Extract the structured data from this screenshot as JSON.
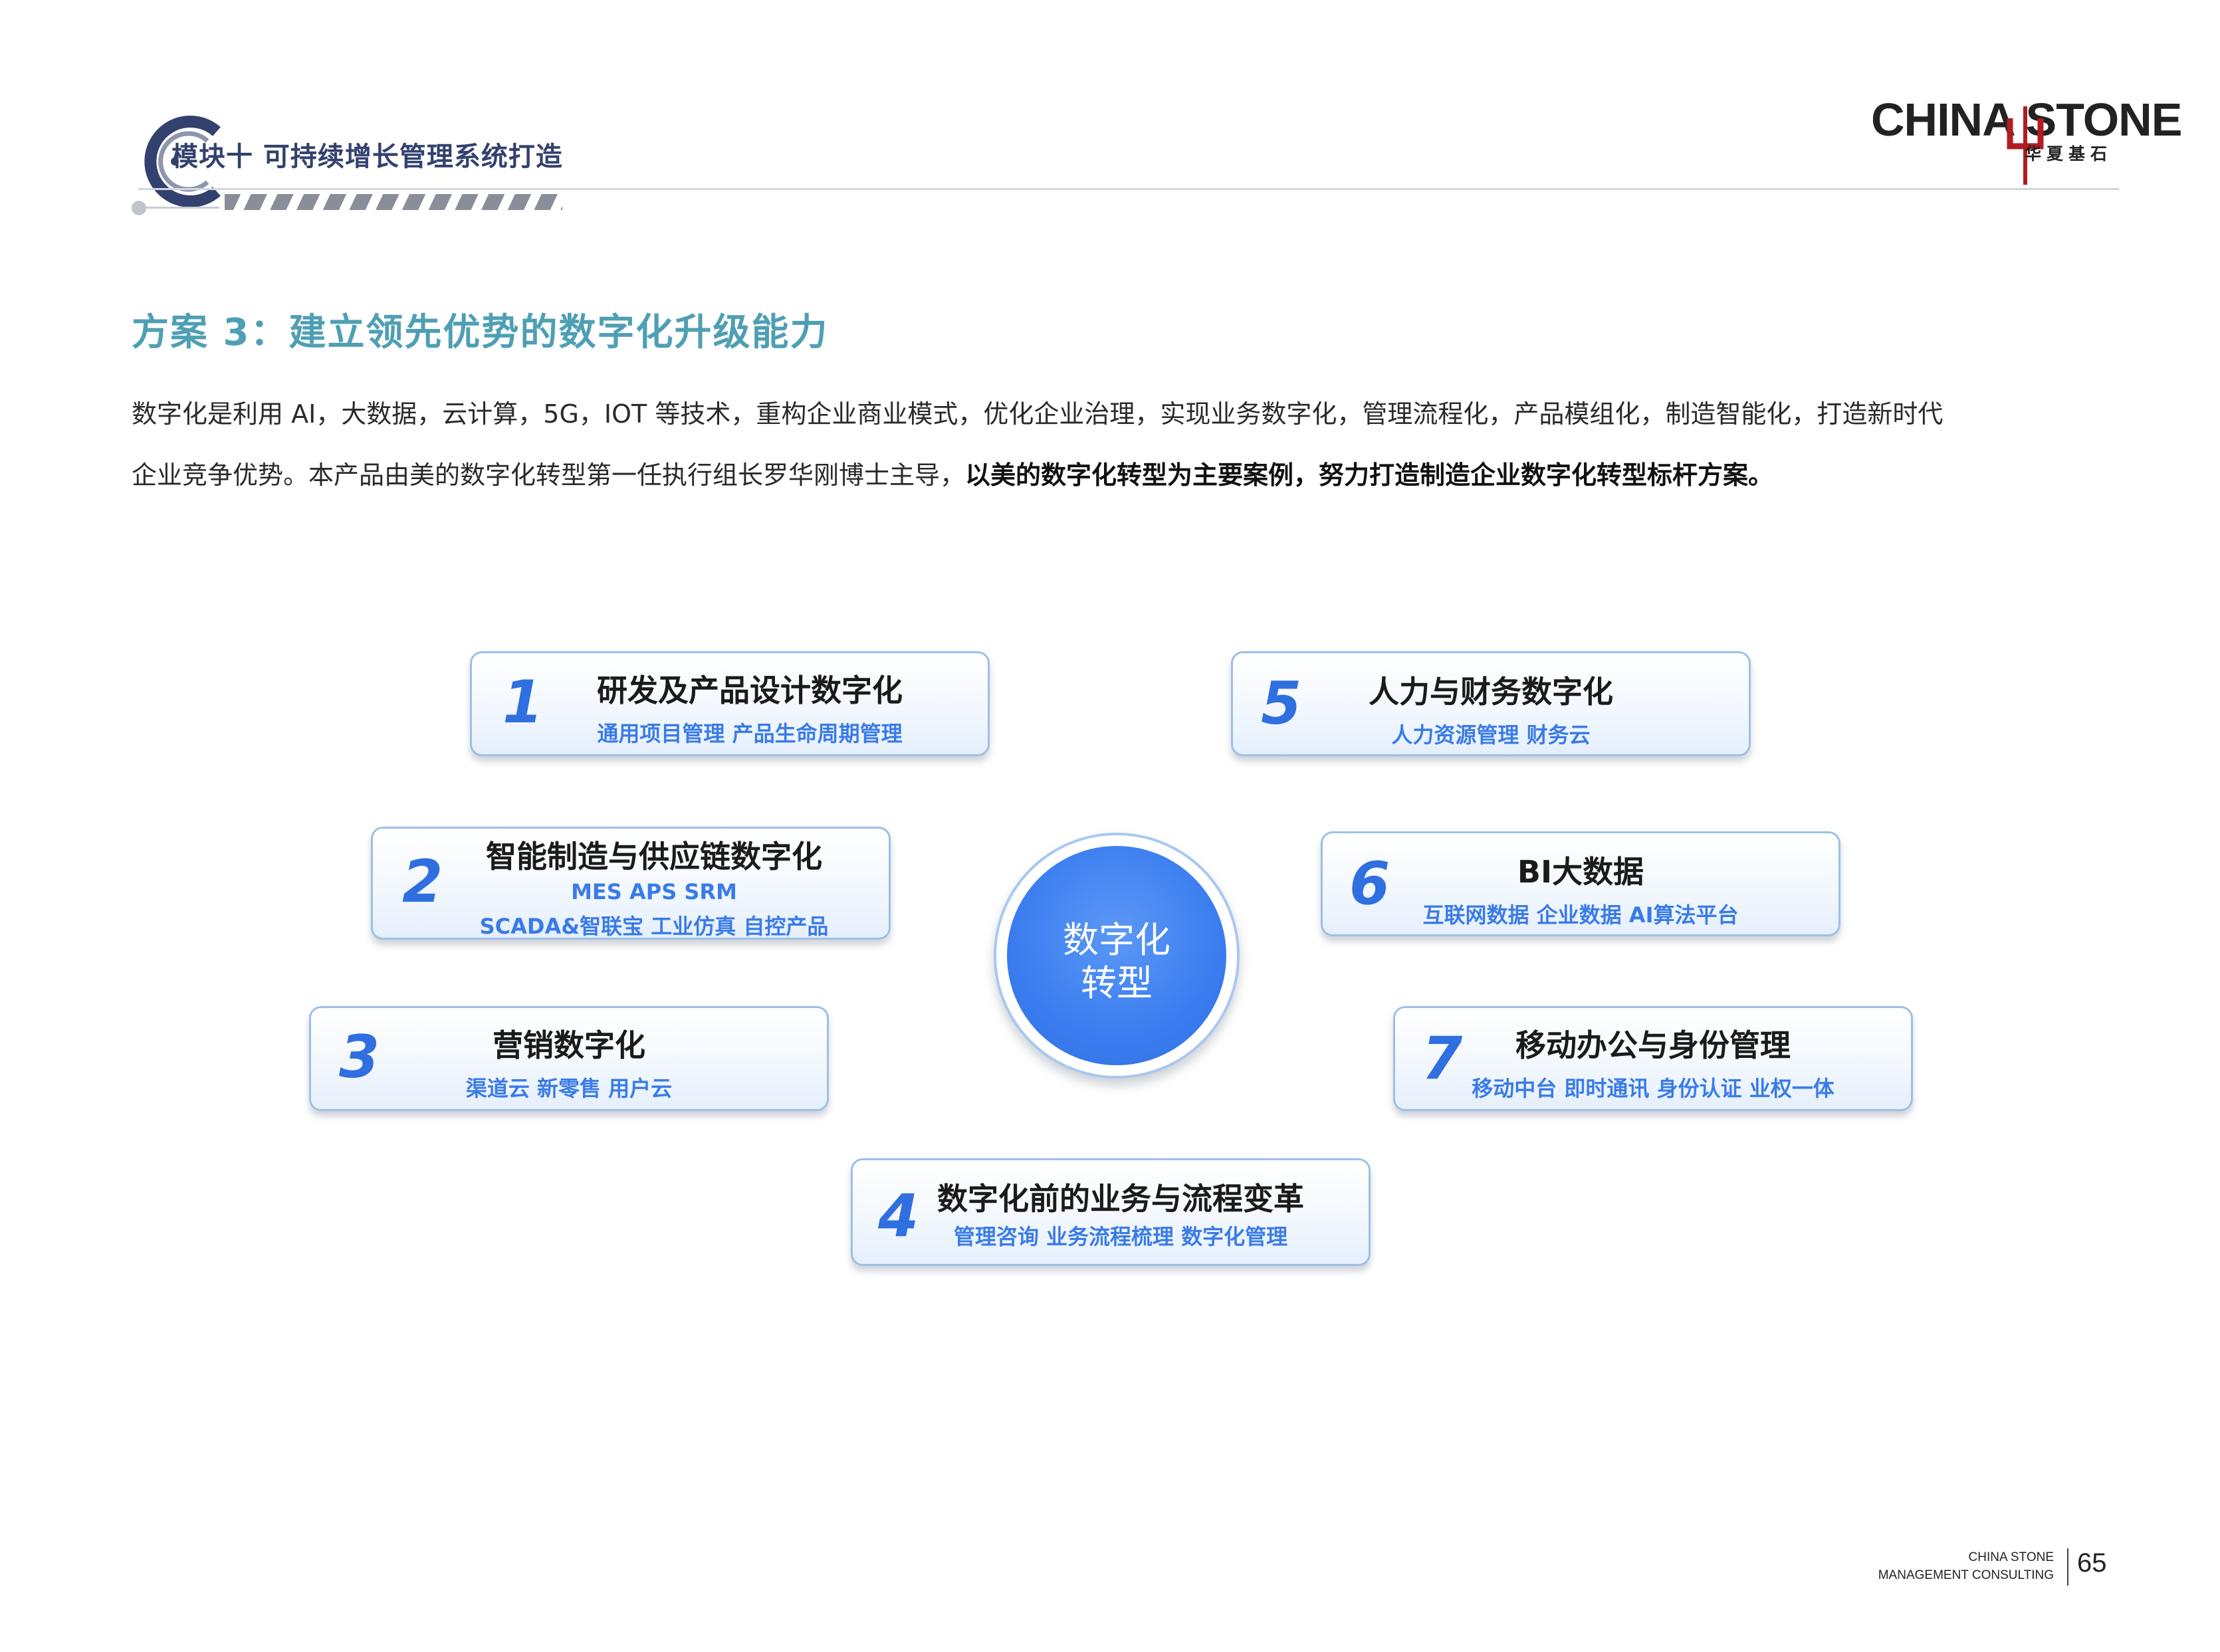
{
  "header": {
    "module_title": "模块十  可持续增长管理系统打造",
    "brand_name": "CHINA STONE",
    "brand_subtitle": "华夏基石"
  },
  "heading": "方案 3：建立领先优势的数字化升级能力",
  "paragraph": {
    "line1": "数字化是利用 AI，大数据，云计算，5G，IOT 等技术，重构企业商业模式，优化企业治理，实现业务数字化，管理流程化，产品模组化，制造智能化，打造新时代",
    "line2_plain": "企业竞争优势。本产品由美的数字化转型第一任执行组长罗华刚博士主导，",
    "line2_bold": "以美的数字化转型为主要案例，努力打造制造企业数字化转型标杆方案。"
  },
  "center": {
    "line1": "数字化",
    "line2": "转型"
  },
  "cards": [
    {
      "num": "1",
      "title": "研发及产品设计数字化",
      "subs": [
        "通用项目管理 产品生命周期管理"
      ]
    },
    {
      "num": "2",
      "title": "智能制造与供应链数字化",
      "subs": [
        "MES APS SRM",
        "SCADA&智联宝 工业仿真 自控产品"
      ]
    },
    {
      "num": "3",
      "title": "营销数字化",
      "subs": [
        "渠道云 新零售 用户云"
      ]
    },
    {
      "num": "4",
      "title": "数字化前的业务与流程变革",
      "subs": [
        "管理咨询 业务流程梳理 数字化管理"
      ]
    },
    {
      "num": "5",
      "title": "人力与财务数字化",
      "subs": [
        "人力资源管理 财务云"
      ]
    },
    {
      "num": "6",
      "title": "BI大数据",
      "subs": [
        "互联网数据 企业数据 AI算法平台"
      ]
    },
    {
      "num": "7",
      "title": "移动办公与身份管理",
      "subs": [
        "移动中台 即时通讯 身份认证 业权一体"
      ]
    }
  ],
  "footer": {
    "line1": "CHINA STONE",
    "line2": "MANAGEMENT CONSULTING",
    "page_number": "65"
  },
  "colors": {
    "heading": "#4f9fb4",
    "accent_blue": "#2f6fe0",
    "subtitle_blue": "#3a7be8",
    "card_border": "#9cc0e6",
    "module_title": "#33416e",
    "brand_red": "#b01d22"
  }
}
